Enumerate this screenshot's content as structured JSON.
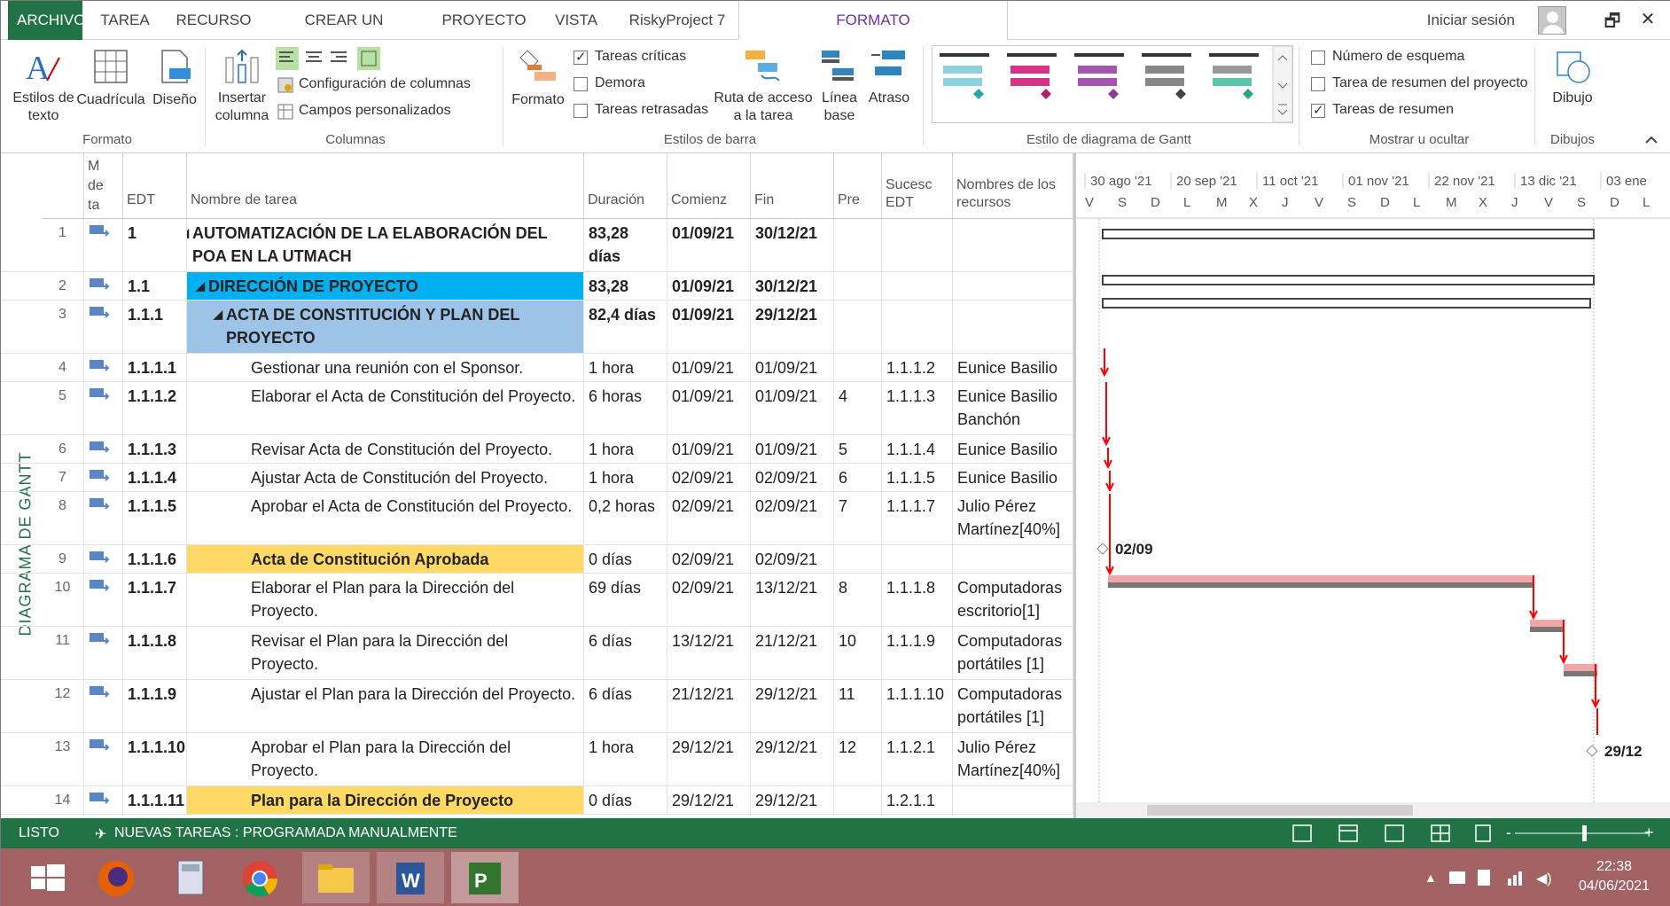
{
  "tabs": [
    "ARCHIVO",
    "TAREA",
    "RECURSO",
    "CREAR UN INFORME",
    "PROYECTO",
    "VISTA",
    "RiskyProject 7",
    "FORMATO"
  ],
  "signin": "Iniciar sesión",
  "window": {
    "restore": "🗗",
    "close": "✕"
  },
  "ribbon": {
    "text_styles": "Estilos de texto",
    "gridlines": "Cuadrícula",
    "layout": "Diseño",
    "insert_column": "Insertar columna",
    "column_settings": "Configuración de columnas",
    "custom_fields": "Campos personalizados",
    "format": "Formato",
    "critical": "Tareas críticas",
    "slack": "Demora",
    "late": "Tareas retrasadas",
    "task_path": "Ruta de acceso a la tarea",
    "baseline": "Línea base",
    "slippage": "Atraso",
    "outline": "Número de esquema",
    "project_summary": "Tarea de resumen del proyecto",
    "summary_tasks": "Tareas de resumen",
    "drawing": "Dibujo",
    "groups": {
      "format": "Formato",
      "columns": "Columnas",
      "bar_styles": "Estilos de barra",
      "gantt_style": "Estilo de diagrama de Gantt",
      "show_hide": "Mostrar u ocultar",
      "drawings": "Dibujos"
    }
  },
  "headers": {
    "mode": "M de ta",
    "edt": "EDT",
    "name": "Nombre de tarea",
    "duration": "Duración",
    "start": "Comienz",
    "finish": "Fin",
    "pred": "Pre",
    "succ": "Sucesc EDT",
    "resources": "Nombres de los recursos"
  },
  "timescale": {
    "top": [
      "30 ago '21",
      "20 sep '21",
      "11 oct '21",
      "01 nov '21",
      "22 nov '21",
      "13 dic '21",
      "03 ene"
    ],
    "bottom": [
      "V",
      "S",
      "D",
      "L",
      "M",
      "X",
      "J",
      "V",
      "S",
      "D",
      "L",
      "M",
      "X",
      "J",
      "V",
      "S",
      "D",
      "L"
    ]
  },
  "side_label": "DIAGRAMA DE GANTT",
  "rows": [
    {
      "n": "1",
      "edt": "1",
      "name": "AUTOMATIZACIÓN DE LA ELABORACIÓN DEL POA EN LA UTMACH",
      "dur": "83,28 días",
      "start": "01/09/21",
      "fin": "30/12/21",
      "pred": "",
      "succ": "",
      "res": ""
    },
    {
      "n": "2",
      "edt": "1.1",
      "name": "DIRECCIÓN DE PROYECTO",
      "dur": "83,28 días",
      "start": "01/09/21",
      "fin": "30/12/21",
      "pred": "",
      "succ": "",
      "res": ""
    },
    {
      "n": "3",
      "edt": "1.1.1",
      "name": "ACTA DE CONSTITUCIÓN Y PLAN DEL PROYECTO",
      "dur": "82,4 días",
      "start": "01/09/21",
      "fin": "29/12/21",
      "pred": "",
      "succ": "",
      "res": ""
    },
    {
      "n": "4",
      "edt": "1.1.1.1",
      "name": "Gestionar una reunión con el Sponsor.",
      "dur": "1 hora",
      "start": "01/09/21",
      "fin": "01/09/21",
      "pred": "",
      "succ": "1.1.1.2",
      "res": "Eunice Basilio E"
    },
    {
      "n": "5",
      "edt": "1.1.1.2",
      "name": "Elaborar el Acta de Constitución del Proyecto.",
      "dur": "6 horas",
      "start": "01/09/21",
      "fin": "01/09/21",
      "pred": "4",
      "succ": "1.1.1.3",
      "res": "Eunice Basilio Banchón"
    },
    {
      "n": "6",
      "edt": "1.1.1.3",
      "name": "Revisar Acta de Constitución del Proyecto.",
      "dur": "1 hora",
      "start": "01/09/21",
      "fin": "01/09/21",
      "pred": "5",
      "succ": "1.1.1.4",
      "res": "Eunice Basilio E"
    },
    {
      "n": "7",
      "edt": "1.1.1.4",
      "name": "Ajustar Acta de Constitución del Proyecto.",
      "dur": "1 hora",
      "start": "02/09/21",
      "fin": "02/09/21",
      "pred": "6",
      "succ": "1.1.1.5",
      "res": "Eunice Basilio E"
    },
    {
      "n": "8",
      "edt": "1.1.1.5",
      "name": "Aprobar el Acta de Constitución del Proyecto.",
      "dur": "0,2 horas",
      "start": "02/09/21",
      "fin": "02/09/21",
      "pred": "7",
      "succ": "1.1.1.7",
      "res": "Julio Pérez Martínez[40%]"
    },
    {
      "n": "9",
      "edt": "1.1.1.6",
      "name": "Acta de Constitución Aprobada",
      "dur": "0 días",
      "start": "02/09/21",
      "fin": "02/09/21",
      "pred": "",
      "succ": "",
      "res": ""
    },
    {
      "n": "10",
      "edt": "1.1.1.7",
      "name": "Elaborar el Plan para la Dirección del Proyecto.",
      "dur": "69 días",
      "start": "02/09/21",
      "fin": "13/12/21",
      "pred": "8",
      "succ": "1.1.1.8",
      "res": "Computadoras escritorio[1]"
    },
    {
      "n": "11",
      "edt": "1.1.1.8",
      "name": "Revisar el Plan para la Dirección del Proyecto.",
      "dur": "6 días",
      "start": "13/12/21",
      "fin": "21/12/21",
      "pred": "10",
      "succ": "1.1.1.9",
      "res": "Computadoras portátiles [1]"
    },
    {
      "n": "12",
      "edt": "1.1.1.9",
      "name": "Ajustar el Plan para la Dirección del Proyecto.",
      "dur": "6 días",
      "start": "21/12/21",
      "fin": "29/12/21",
      "pred": "11",
      "succ": "1.1.1.10",
      "res": "Computadoras portátiles [1]"
    },
    {
      "n": "13",
      "edt": "1.1.1.10",
      "name": "Aprobar el Plan para la Dirección del Proyecto.",
      "dur": "1 hora",
      "start": "29/12/21",
      "fin": "29/12/21",
      "pred": "12",
      "succ": "1.1.2.1",
      "res": "Julio Pérez Martínez[40%]"
    },
    {
      "n": "14",
      "edt": "1.1.1.11",
      "name": "Plan para la Dirección de Proyecto",
      "dur": "0 días",
      "start": "29/12/21",
      "fin": "29/12/21",
      "pred": "",
      "succ": "1.2.1.1",
      "res": ""
    }
  ],
  "milestones": {
    "m1": "02/09",
    "m2": "29/12"
  },
  "status": {
    "ready": "LISTO",
    "new_tasks": "NUEVAS TAREAS : PROGRAMADA MANUALMENTE"
  },
  "clock": {
    "time": "22:38",
    "date": "04/06/2021"
  },
  "colors": {
    "accent": "#217346",
    "format_tab": "#7030a0",
    "summary_blue": "#00b0f0",
    "summary_light": "#9dc3e6",
    "milestone_row": "#ffd966",
    "critical": "#ff0000",
    "taskbar": "#a36365"
  }
}
